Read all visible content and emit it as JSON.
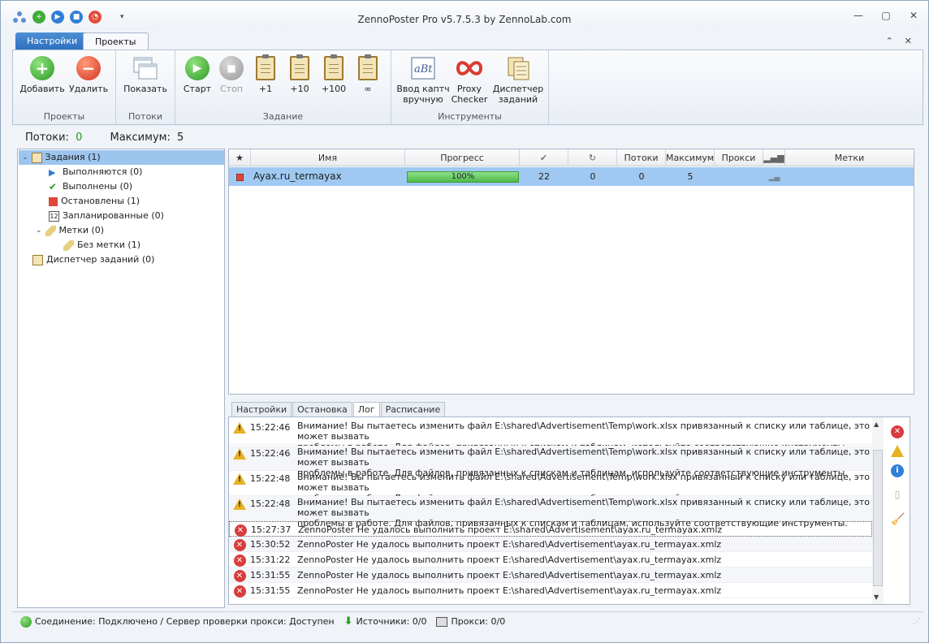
{
  "window": {
    "title": "ZennoPoster Pro v5.7.5.3 by ZennoLab.com"
  },
  "tabs": [
    {
      "label": "Настройки"
    },
    {
      "label": "Проекты"
    }
  ],
  "ribbon": {
    "groups": [
      {
        "label": "Проекты",
        "buttons": [
          {
            "label": "Добавить"
          },
          {
            "label": "Удалить"
          }
        ]
      },
      {
        "label": "Потоки",
        "buttons": [
          {
            "label": "Показать"
          }
        ]
      },
      {
        "label": "Задание",
        "buttons": [
          {
            "label": "Старт"
          },
          {
            "label": "Стоп"
          },
          {
            "label": "+1"
          },
          {
            "label": "+10"
          },
          {
            "label": "+100"
          },
          {
            "label": "∞"
          }
        ]
      },
      {
        "label": "Инструменты",
        "buttons": [
          {
            "label1": "Ввод каптч",
            "label2": "вручную"
          },
          {
            "label1": "Proxy",
            "label2": "Checker"
          },
          {
            "label1": "Диспетчер",
            "label2": "заданий"
          }
        ]
      }
    ]
  },
  "threads": {
    "label": "Потоки:",
    "value": "0",
    "max_label": "Максимум:",
    "max_value": "5",
    "value_color": "#1e9a1e"
  },
  "tree": [
    {
      "label": "Задания (1)"
    },
    {
      "label": "Выполняются (0)"
    },
    {
      "label": "Выполнены (0)"
    },
    {
      "label": "Остановлены (1)"
    },
    {
      "label": "Запланированные (0)"
    },
    {
      "label": "Метки (0)"
    },
    {
      "label": "Без метки (1)"
    },
    {
      "label": "Диспетчер заданий (0)"
    }
  ],
  "table": {
    "headers": {
      "name": "Имя",
      "progress": "Прогресс",
      "threads": "Потоки",
      "max": "Максимум",
      "proxy": "Прокси",
      "tags": "Метки"
    },
    "rows": [
      {
        "name": "Ayax.ru_termayax",
        "progress": "100%",
        "progress_value": 100,
        "done": "22",
        "retries": "0",
        "threads": "0",
        "max": "5",
        "proxy": "",
        "tags": ""
      }
    ]
  },
  "bottom_tabs": [
    {
      "label": "Настройки"
    },
    {
      "label": "Остановка"
    },
    {
      "label": "Лог"
    },
    {
      "label": "Расписание"
    }
  ],
  "log": [
    {
      "type": "warning",
      "time": "15:22:46",
      "line1": "Внимание! Вы пытаетесь изменить файл E:\\shared\\Advertisement\\Temp\\work.xlsx привязанный к списку или таблице, это может вызвать",
      "line2": "проблемы в работе. Для файлов, привязанных к спискам и таблицам, используйте соответствующие инструменты."
    },
    {
      "type": "warning",
      "time": "15:22:46",
      "line1": "Внимание! Вы пытаетесь изменить файл E:\\shared\\Advertisement\\Temp\\work.xlsx привязанный к списку или таблице, это может вызвать",
      "line2": "проблемы в работе. Для файлов, привязанных к спискам и таблицам, используйте соответствующие инструменты."
    },
    {
      "type": "warning",
      "time": "15:22:48",
      "line1": "Внимание! Вы пытаетесь изменить файл E:\\shared\\Advertisement\\Temp\\work.xlsx привязанный к списку или таблице, это может вызвать",
      "line2": "проблемы в работе. Для файлов, привязанных к спискам и таблицам, используйте соответствующие инструменты."
    },
    {
      "type": "warning",
      "time": "15:22:48",
      "line1": "Внимание! Вы пытаетесь изменить файл E:\\shared\\Advertisement\\Temp\\work.xlsx привязанный к списку или таблице, это может вызвать",
      "line2": "проблемы в работе. Для файлов, привязанных к спискам и таблицам, используйте соответствующие инструменты."
    },
    {
      "type": "error",
      "time": "15:27:37",
      "line1": "ZennoPoster Не удалось выполнить проект E:\\shared\\Advertisement\\ayax.ru_termayax.xmlz",
      "line2": ""
    },
    {
      "type": "error",
      "time": "15:30:52",
      "line1": "ZennoPoster Не удалось выполнить проект E:\\shared\\Advertisement\\ayax.ru_termayax.xmlz",
      "line2": ""
    },
    {
      "type": "error",
      "time": "15:31:22",
      "line1": "ZennoPoster Не удалось выполнить проект E:\\shared\\Advertisement\\ayax.ru_termayax.xmlz",
      "line2": ""
    },
    {
      "type": "error",
      "time": "15:31:55",
      "line1": "ZennoPoster Не удалось выполнить проект E:\\shared\\Advertisement\\ayax.ru_termayax.xmlz",
      "line2": ""
    },
    {
      "type": "error",
      "time": "15:31:55",
      "line1": "ZennoPoster Не удалось выполнить проект E:\\shared\\Advertisement\\ayax.ru_termayax.xmlz",
      "line2": ""
    }
  ],
  "statusbar": {
    "connection": "Соединение: Подключено / Сервер проверки прокси: Доступен",
    "sources": "Источники: 0/0",
    "proxies": "Прокси: 0/0"
  }
}
